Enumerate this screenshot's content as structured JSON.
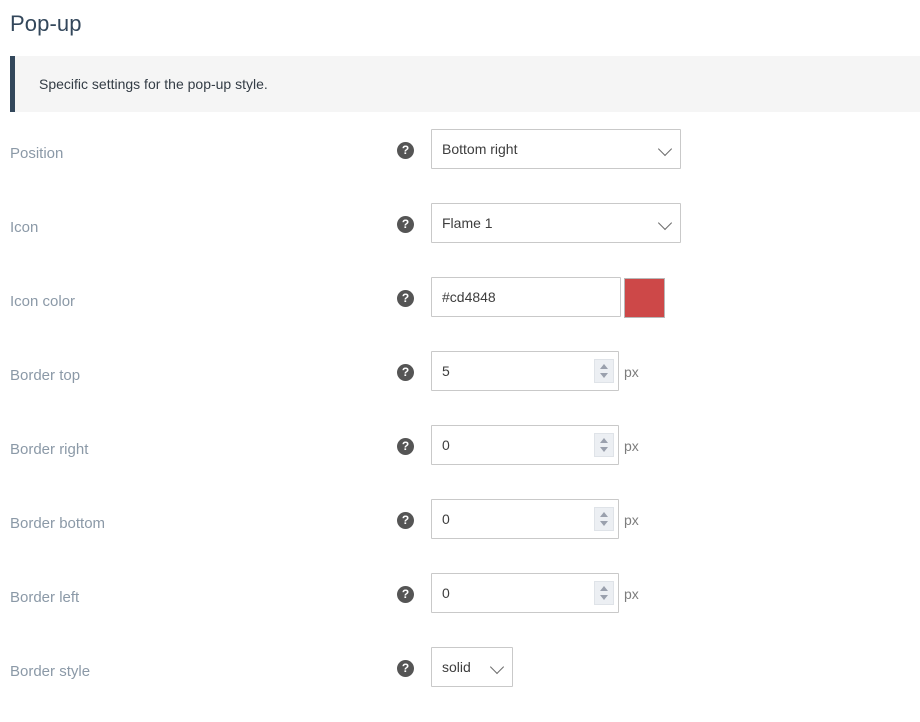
{
  "page": {
    "title": "Pop-up"
  },
  "info": {
    "text": "Specific settings for the pop-up style.",
    "accent_color": "#33475b",
    "background_color": "#f5f5f5"
  },
  "help_icon_glyph": "?",
  "fields": [
    {
      "label": "Position",
      "type": "select",
      "value": "Bottom right",
      "options": [
        "Bottom right"
      ]
    },
    {
      "label": "Icon",
      "type": "select",
      "value": "Flame 1",
      "options": [
        "Flame 1"
      ]
    },
    {
      "label": "Icon color",
      "type": "color",
      "value": "#cd4848",
      "swatch_color": "#cd4848"
    },
    {
      "label": "Border top",
      "type": "number",
      "value": "5",
      "unit": "px"
    },
    {
      "label": "Border right",
      "type": "number",
      "value": "0",
      "unit": "px"
    },
    {
      "label": "Border bottom",
      "type": "number",
      "value": "0",
      "unit": "px"
    },
    {
      "label": "Border left",
      "type": "number",
      "value": "0",
      "unit": "px"
    },
    {
      "label": "Border style",
      "type": "select-small",
      "value": "solid",
      "options": [
        "solid"
      ]
    }
  ]
}
